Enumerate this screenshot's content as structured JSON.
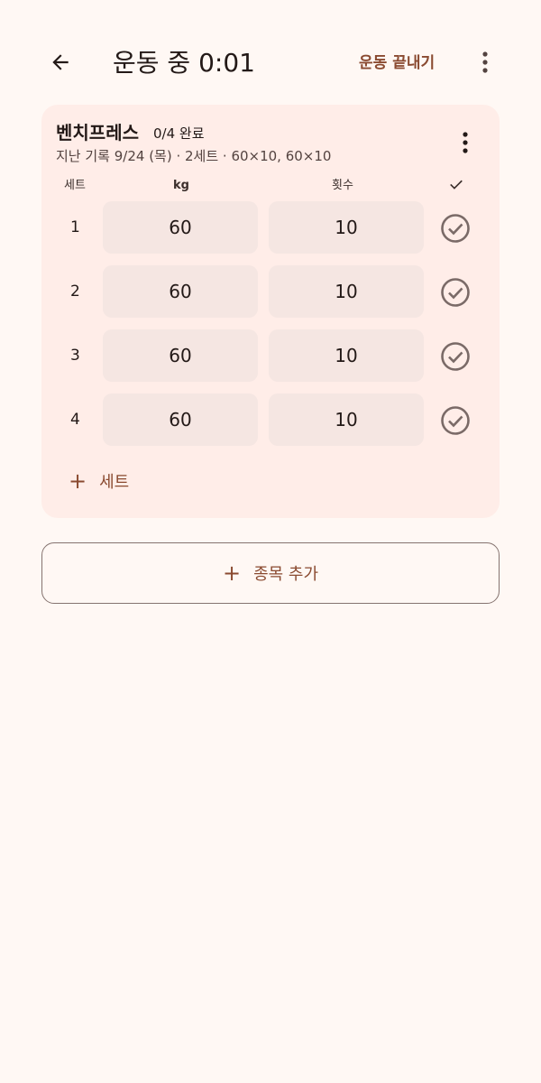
{
  "header": {
    "title": "운동 중 0:01",
    "finish_label": "운동 끝내기"
  },
  "exercise": {
    "name": "벤치프레스",
    "progress": "0/4 완료",
    "history": "지난 기록 9/24 (목) · 2세트 · 60×10, 60×10",
    "columns": {
      "set": "세트",
      "kg": "kg",
      "reps": "횟수",
      "check": "✓"
    },
    "sets": [
      {
        "num": "1",
        "kg": "60",
        "reps": "10",
        "done": false
      },
      {
        "num": "2",
        "kg": "60",
        "reps": "10",
        "done": false
      },
      {
        "num": "3",
        "kg": "60",
        "reps": "10",
        "done": false
      },
      {
        "num": "4",
        "kg": "60",
        "reps": "10",
        "done": false
      }
    ],
    "add_set_label": "세트"
  },
  "add_exercise_label": "종목 추가",
  "colors": {
    "background": "#FFF8F4",
    "card": "#FFEDE8",
    "accent": "#8A4A30",
    "field": "#F5E6E2"
  },
  "icons": {
    "back": "arrow-left-icon",
    "more": "more-vert-icon",
    "check": "check-circle-icon",
    "add": "plus-icon"
  }
}
